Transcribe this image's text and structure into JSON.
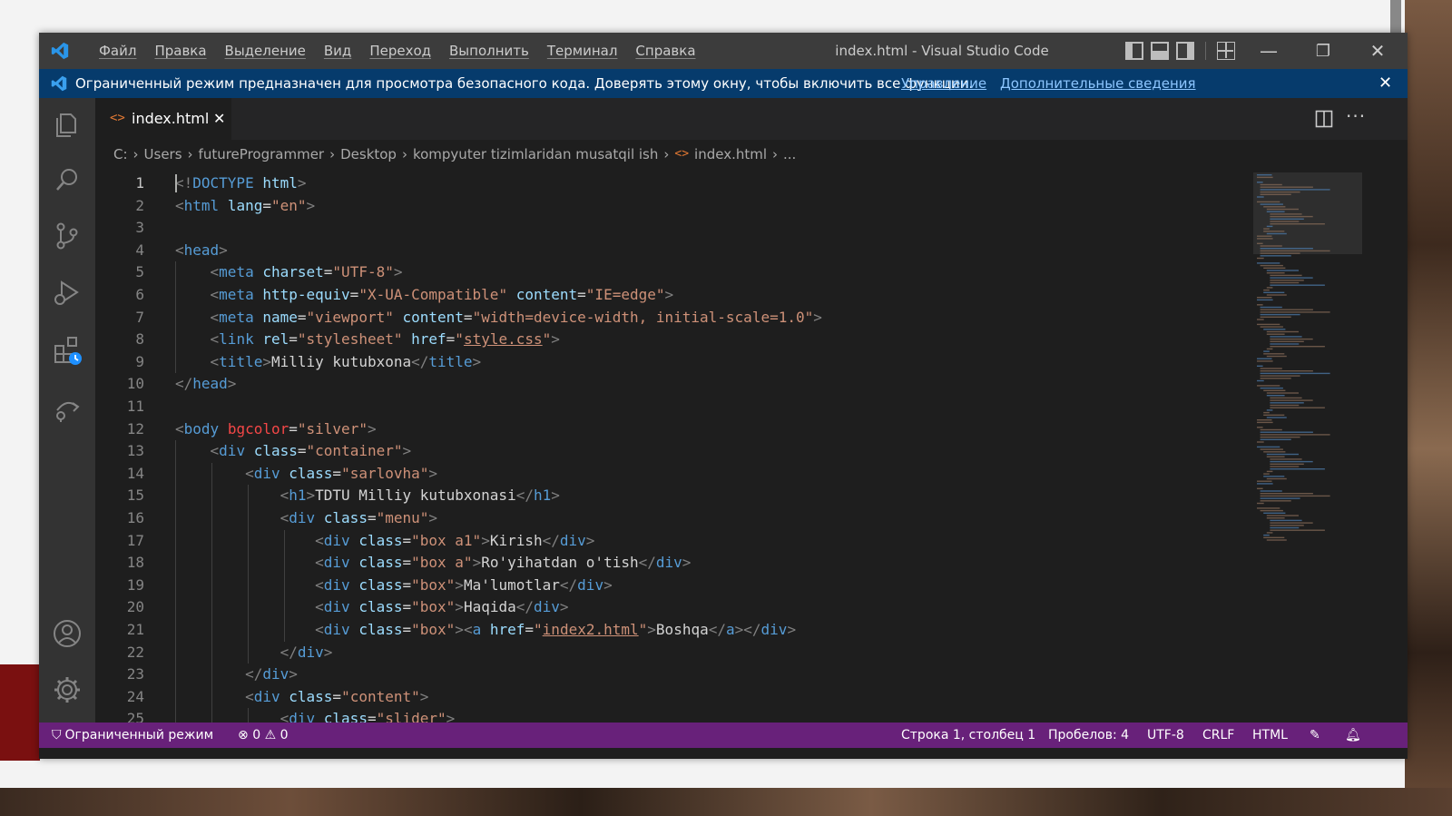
{
  "window": {
    "title": "index.html - Visual Studio Code",
    "menus": [
      "Файл",
      "Правка",
      "Выделение",
      "Вид",
      "Переход",
      "Выполнить",
      "Терминал",
      "Справка"
    ]
  },
  "banner": {
    "text": "Ограниченный режим предназначен для просмотра безопасного кода. Доверять этому окну, чтобы включить все функции.",
    "manage_link": "Управление",
    "more_link": "Дополнительные сведения"
  },
  "tab": {
    "label": "index.html",
    "icon": "html-file-icon"
  },
  "breadcrumb": [
    "C:",
    "Users",
    "futureProgrammer",
    "Desktop",
    "kompyuter tizimlaridan musatqil ish",
    "index.html",
    "..."
  ],
  "editor": {
    "active_line": 1,
    "lines": [
      "<!DOCTYPE html>",
      "<html lang=\"en\">",
      "",
      "<head>",
      "    <meta charset=\"UTF-8\">",
      "    <meta http-equiv=\"X-UA-Compatible\" content=\"IE=edge\">",
      "    <meta name=\"viewport\" content=\"width=device-width, initial-scale=1.0\">",
      "    <link rel=\"stylesheet\" href=\"style.css\">",
      "    <title>Milliy kutubxona</title>",
      "</head>",
      "",
      "<body bgcolor=\"silver\">",
      "    <div class=\"container\">",
      "        <div class=\"sarlovha\">",
      "            <h1>TDTU Milliy kutubxonasi</h1>",
      "            <div class=\"menu\">",
      "                <div class=\"box a1\">Kirish</div>",
      "                <div class=\"box a\">Ro'yihatdan o'tish</div>",
      "                <div class=\"box\">Ma'lumotlar</div>",
      "                <div class=\"box\">Haqida</div>",
      "                <div class=\"box\"><a href=\"index2.html\">Boshqa</a></div>",
      "            </div>",
      "        </div>",
      "        <div class=\"content\">",
      "            <div class=\"slider\">"
    ]
  },
  "statusbar": {
    "restricted": "Ограниченный режим",
    "errors": "0",
    "warnings": "0",
    "position": "Строка 1, столбец 1",
    "spaces": "Пробелов: 4",
    "encoding": "UTF-8",
    "eol": "CRLF",
    "language": "HTML"
  },
  "colors": {
    "titlebar": "#3c3c3c",
    "banner": "#063b6c",
    "activitybar": "#333333",
    "editor": "#1e1e1e",
    "statusbar": "#68217a"
  }
}
